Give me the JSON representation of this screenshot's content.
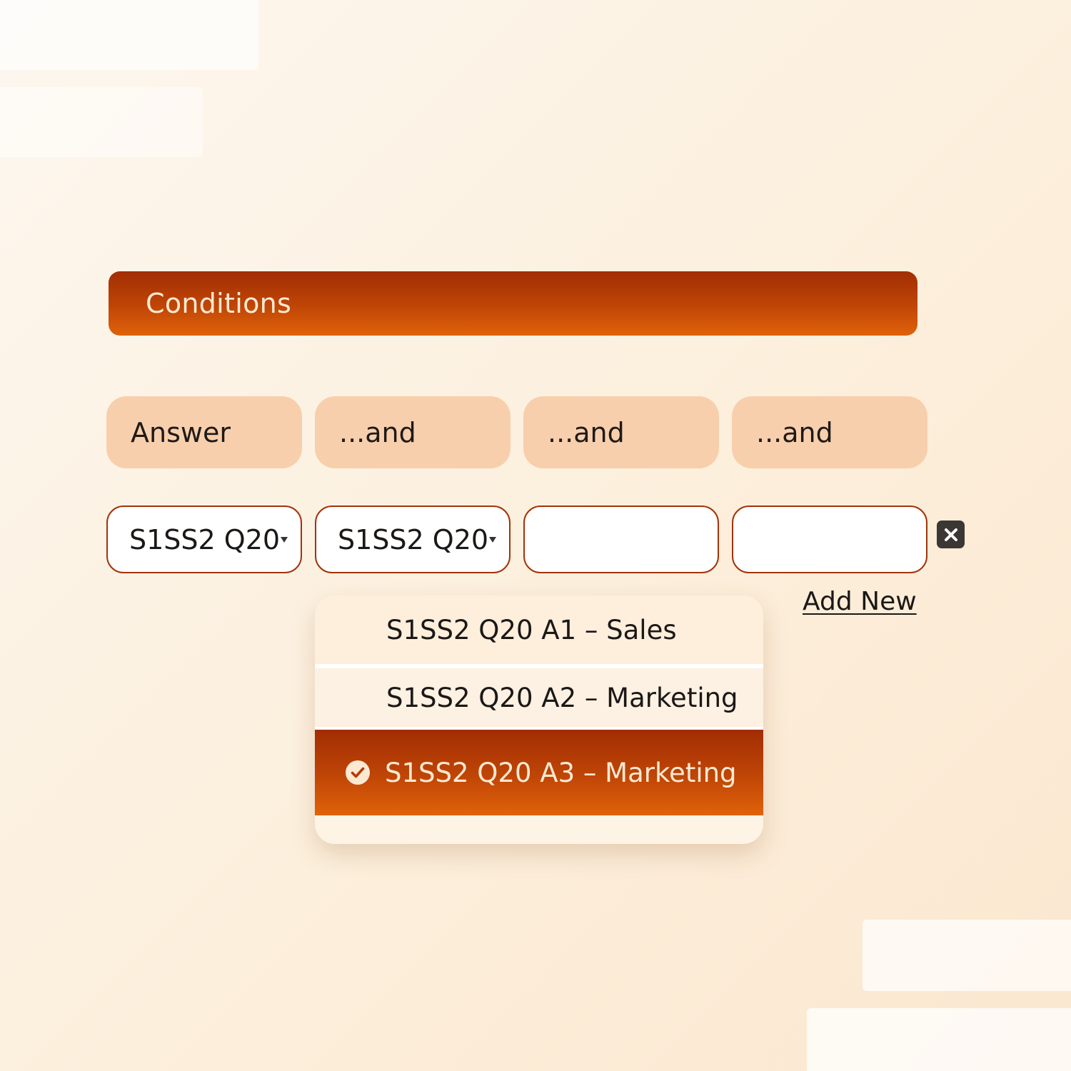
{
  "header": {
    "title": "Conditions"
  },
  "column_labels": [
    "Answer",
    "...and",
    "...and",
    "...and"
  ],
  "selects": [
    {
      "value": "S1SS2 Q20",
      "has_dropdown": true
    },
    {
      "value": "S1SS2 Q20",
      "has_dropdown": true
    },
    {
      "value": "",
      "has_dropdown": false
    },
    {
      "value": "",
      "has_dropdown": false
    }
  ],
  "actions": {
    "add_new_label": "Add New",
    "remove_icon": "close-icon"
  },
  "dropdown": {
    "options": [
      {
        "label": "S1SS2 Q20 A1 – Sales",
        "selected": false
      },
      {
        "label": "S1SS2 Q20 A2 – Marketing",
        "selected": false
      },
      {
        "label": "S1SS2 Q20 A3 – Marketing",
        "selected": true
      }
    ],
    "selected_icon": "check-circle-icon"
  },
  "colors": {
    "accent_dark": "#a12d04",
    "accent_light": "#e0620a",
    "label_pill_bg": "#f8cfac",
    "select_border": "#a3330a"
  }
}
